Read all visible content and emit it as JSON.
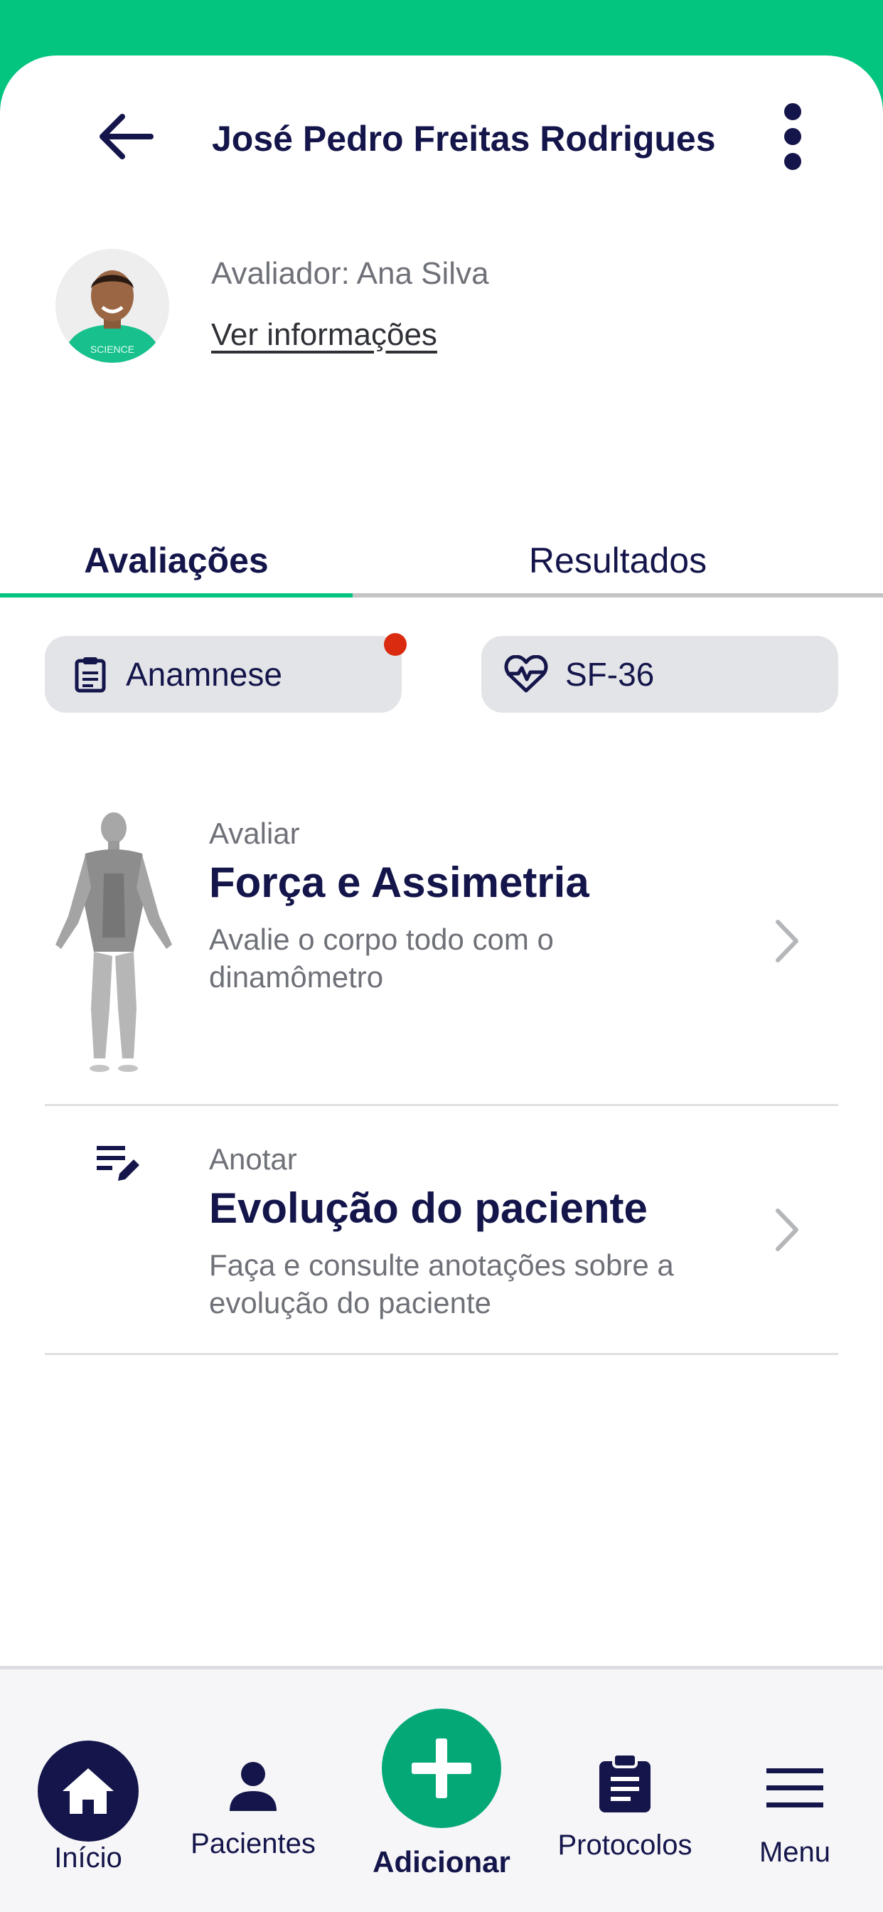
{
  "header": {
    "title": "José Pedro Freitas Rodrigues",
    "back_icon": "arrow-left-icon",
    "more_icon": "more-vertical-icon"
  },
  "profile": {
    "evaluator": "Avaliador: Ana Silva",
    "info_link": "Ver informações",
    "avatar_shirt_text": "SCIENCE"
  },
  "tabs": [
    {
      "label": "Avaliações",
      "active": true
    },
    {
      "label": "Resultados",
      "active": false
    }
  ],
  "chips": [
    {
      "label": "Anamnese",
      "icon": "clipboard-icon",
      "notification": true
    },
    {
      "label": "SF-36",
      "icon": "heart-pulse-icon",
      "notification": false
    }
  ],
  "cards": [
    {
      "kicker": "Avaliar",
      "title": "Força e Assimetria",
      "desc_line1": "Avalie o corpo todo com o",
      "desc_line2": "dinamômetro",
      "icon": "body-muscles-icon"
    },
    {
      "kicker": "Anotar",
      "title": "Evolução do paciente",
      "desc_line1": "Faça e consulte anotações sobre a",
      "desc_line2": "evolução do paciente",
      "icon": "notes-edit-icon"
    }
  ],
  "nav": [
    {
      "label": "Início",
      "icon": "home-icon",
      "active": true
    },
    {
      "label": "Pacientes",
      "icon": "person-icon",
      "active": false
    },
    {
      "label": "Adicionar",
      "icon": "plus-icon",
      "active": false
    },
    {
      "label": "Protocolos",
      "icon": "clipboard-list-icon",
      "active": false
    },
    {
      "label": "Menu",
      "icon": "menu-icon",
      "active": false
    }
  ],
  "colors": {
    "brand_green": "#04c57f",
    "navy": "#14154a",
    "add_button": "#04a877",
    "notification": "#da2a0f"
  }
}
